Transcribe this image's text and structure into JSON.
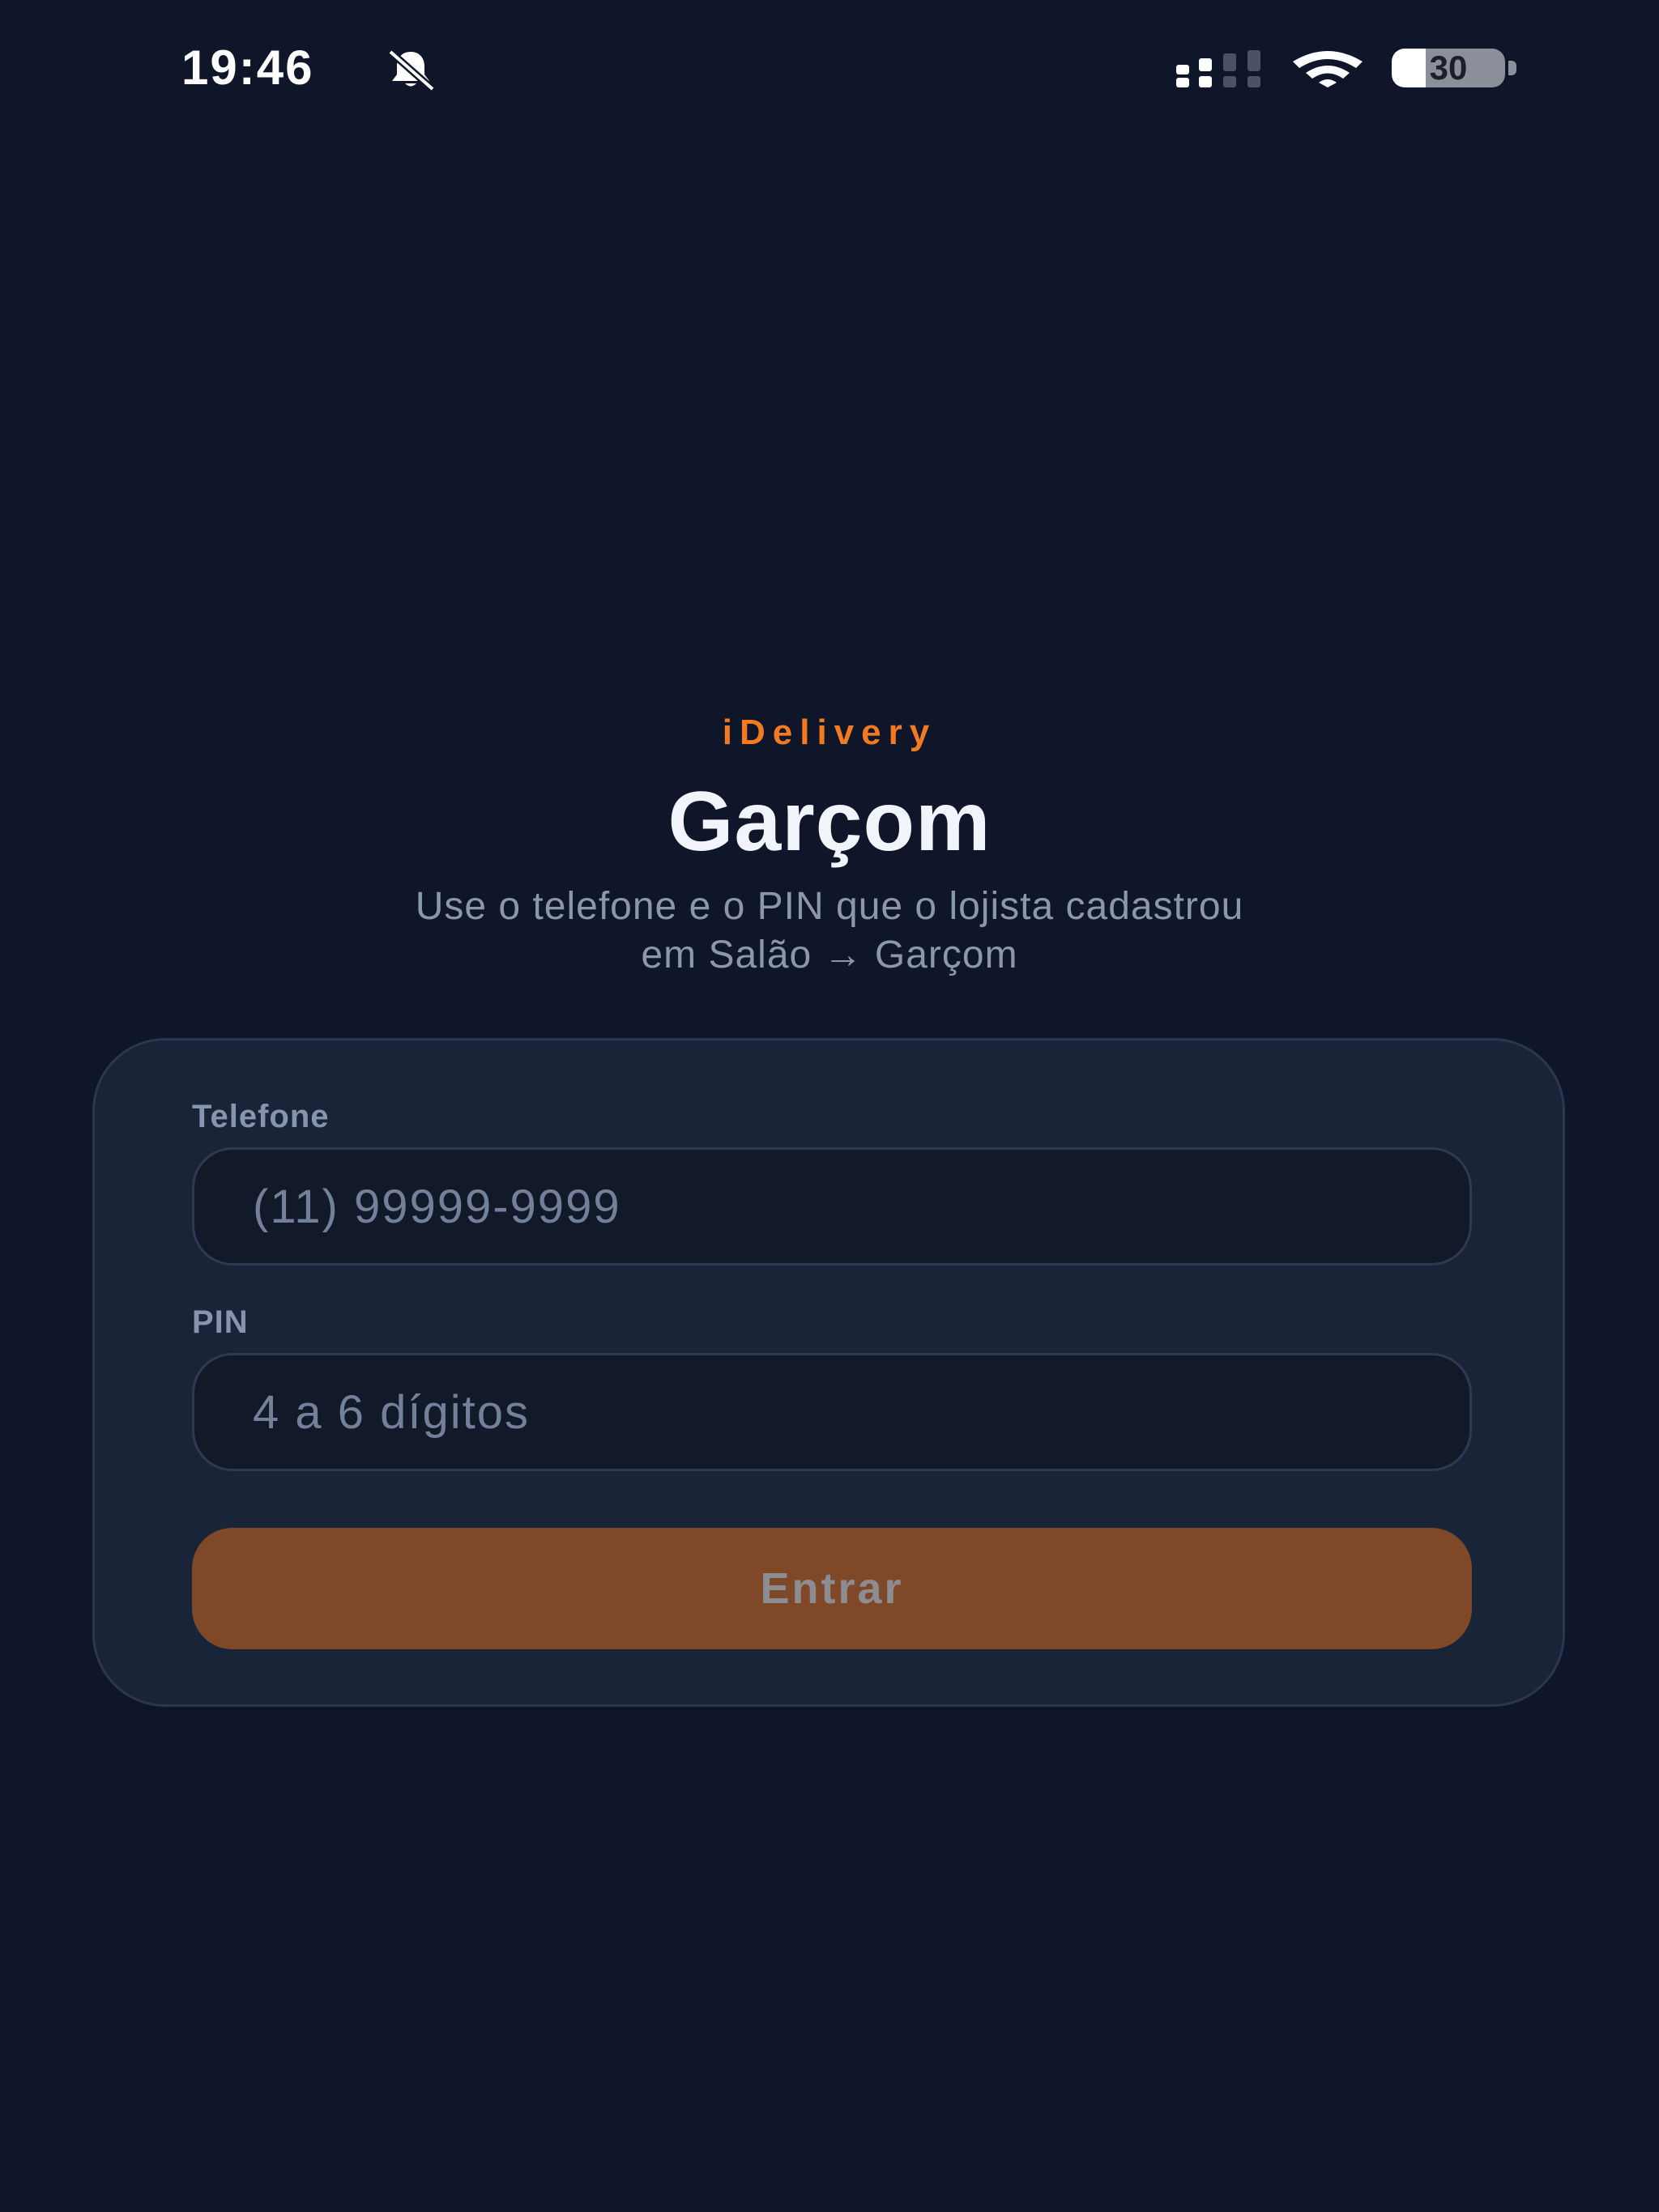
{
  "status_bar": {
    "time": "19:46",
    "battery_level": "30",
    "battery_fraction": 0.3,
    "icons": [
      "bell-off-icon",
      "signal-icon",
      "wifi-icon",
      "battery-icon"
    ]
  },
  "header": {
    "brand": "iDelivery",
    "title": "Garçom",
    "subtitle_line1": "Use o telefone e o PIN que o lojista cadastrou",
    "subtitle_line2": "em Salão → Garçom"
  },
  "form": {
    "phone": {
      "label": "Telefone",
      "placeholder": "(11) 99999-9999",
      "value": ""
    },
    "pin": {
      "label": "PIN",
      "placeholder": "4 a 6 dígitos",
      "value": ""
    },
    "submit_label": "Entrar"
  },
  "colors": {
    "background": "#0f1629",
    "card": "#1a2438",
    "accent": "#f27a22",
    "button": "#7f4829"
  }
}
